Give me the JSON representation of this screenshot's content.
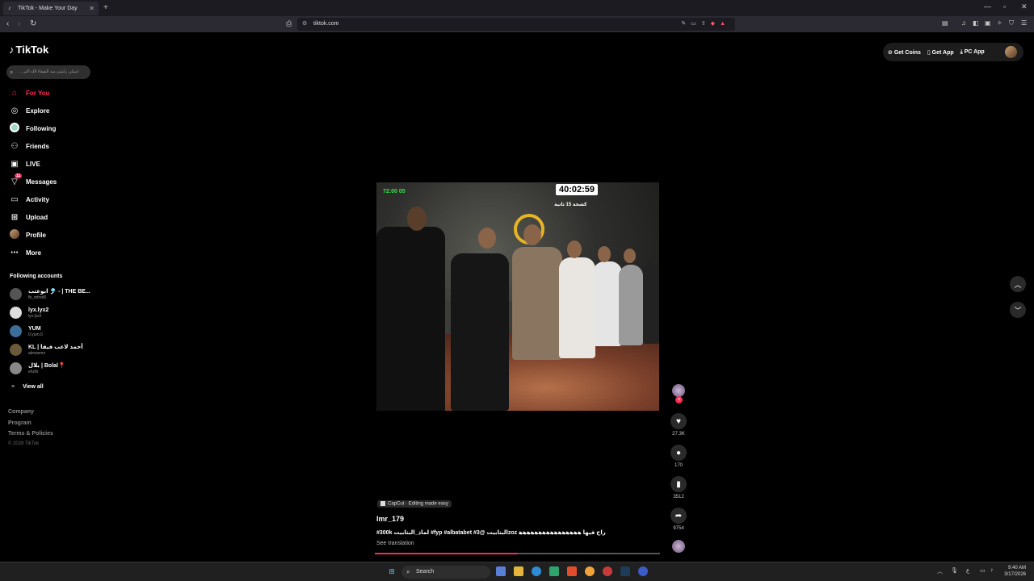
{
  "browser": {
    "tab_title": "TikTok - Make Your Day",
    "new_tab": "+",
    "url": "tiktok.com"
  },
  "brand": {
    "logo": "TikTok"
  },
  "search": {
    "placeholder": "... اسكي ركبتين منه الشفاء الله اكبر"
  },
  "nav": [
    {
      "label": "For You",
      "icon": "home-icon"
    },
    {
      "label": "Explore",
      "icon": "compass-icon"
    },
    {
      "label": "Following",
      "icon": "following-icon"
    },
    {
      "label": "Friends",
      "icon": "friends-icon"
    },
    {
      "label": "LIVE",
      "icon": "live-icon"
    },
    {
      "label": "Messages",
      "icon": "messages-icon",
      "badge": "11"
    },
    {
      "label": "Activity",
      "icon": "activity-icon"
    },
    {
      "label": "Upload",
      "icon": "upload-icon"
    },
    {
      "label": "Profile",
      "icon": "profile-icon"
    },
    {
      "label": "More",
      "icon": "more-icon"
    }
  ],
  "following": {
    "title": "Following accounts",
    "accounts": [
      {
        "name": "ابوعتب 🎐 - | THE BE...",
        "handle": "fb_mfrsd0"
      },
      {
        "name": "lyx.lyx2",
        "handle": "lyx.lyx2"
      },
      {
        "name": "YUM",
        "handle": "0.yum.0"
      },
      {
        "name": "KL | أحمد لاعب فيفا",
        "handle": "almzwmo"
      },
      {
        "name": "بلال | Bolal📍",
        "handle": "ehz8r"
      }
    ],
    "view_all": "View all"
  },
  "footer": {
    "company": "Company",
    "program": "Program",
    "terms": "Terms & Policies",
    "copyright": "© 2026 TikTok"
  },
  "topbar": {
    "coins": "Get Coins",
    "app": "Get App",
    "pc_app": "PC App"
  },
  "video": {
    "timer": "40:02:59",
    "overlay_text": "كشخة 15 ثانية",
    "green_text": "72:00 05",
    "progress": 0.5
  },
  "actions": {
    "likes": "27.3K",
    "comments": "170",
    "saves": "3512",
    "shares": "9754"
  },
  "caption": {
    "capcut": "CapCut · Editing made easy",
    "author": "lmr_179",
    "text": "#300k لماذ_البتابيت #fyp #albatabet #البتابيت @3zoz راح فيها ﻫ﻿ﻫﻫﻫﻫﻫﻫﻫﻫﻫﻫﻫﻫﻫﻫﻫ",
    "see_translation": "See translation"
  },
  "taskbar": {
    "search": "Search",
    "time": "9:40 AM",
    "date": "3/17/2026"
  }
}
